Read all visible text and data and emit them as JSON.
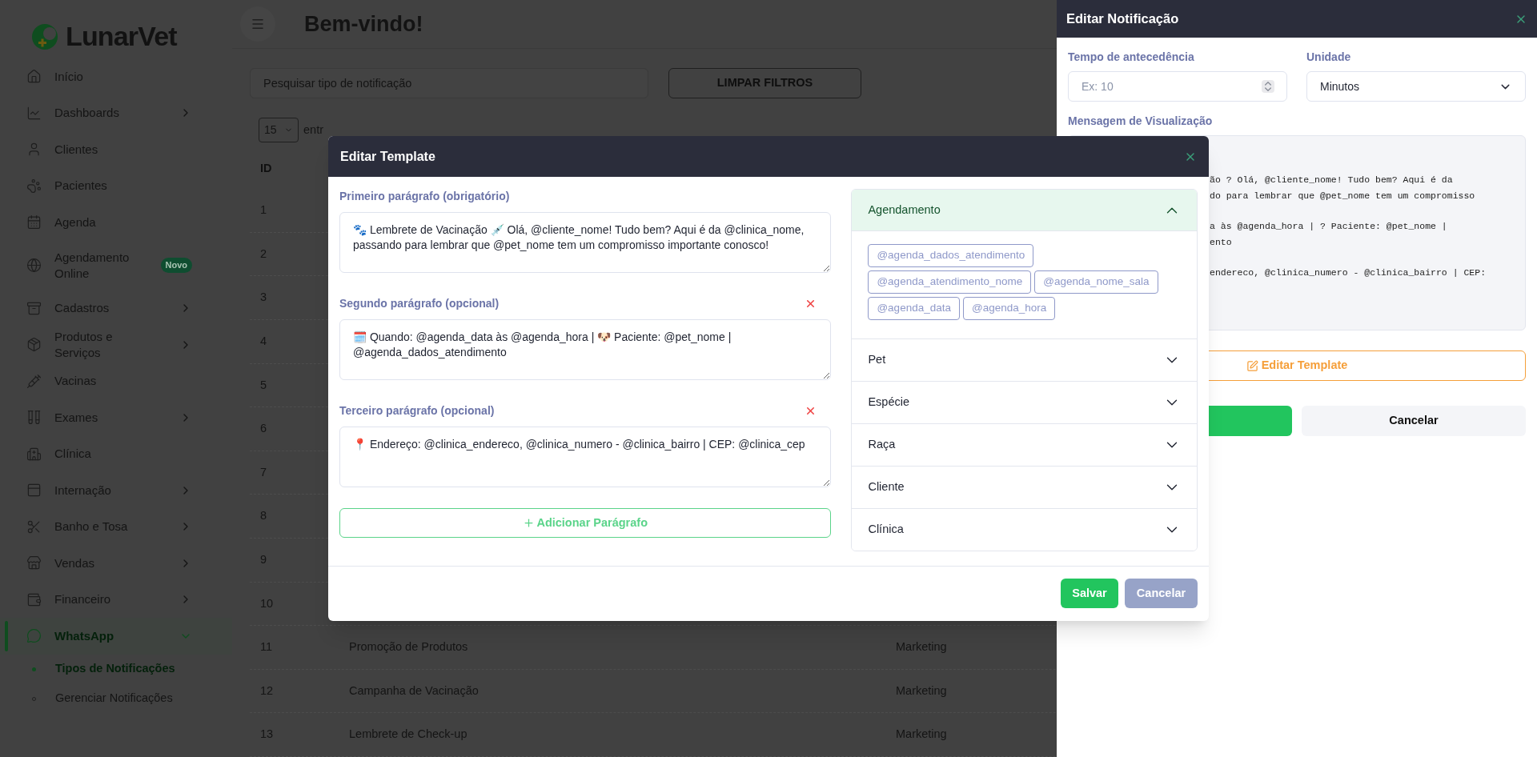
{
  "sidebar": {
    "logo": "LunarVet",
    "items": [
      {
        "label": "Início",
        "expandable": false,
        "selected": false
      },
      {
        "label": "Dashboards",
        "expandable": true,
        "expanded": false,
        "selected": false
      },
      {
        "label": "Clientes",
        "expandable": false,
        "selected": false
      },
      {
        "label": "Pacientes",
        "expandable": false,
        "selected": false
      },
      {
        "label": "Agenda",
        "expandable": false,
        "selected": false
      },
      {
        "label": "Agendamento Online",
        "expandable": false,
        "selected": false,
        "badge": "Novo"
      },
      {
        "label": "Cadastros",
        "expandable": true,
        "expanded": false,
        "selected": false
      },
      {
        "label": "Produtos e Serviços",
        "expandable": true,
        "expanded": false,
        "selected": false
      },
      {
        "label": "Vacinas",
        "expandable": false,
        "selected": false
      },
      {
        "label": "Exames",
        "expandable": true,
        "expanded": false,
        "selected": false
      },
      {
        "label": "Clínica",
        "expandable": false,
        "selected": false
      },
      {
        "label": "Internação",
        "expandable": true,
        "expanded": false,
        "selected": false
      },
      {
        "label": "Banho e Tosa",
        "expandable": true,
        "expanded": false,
        "selected": false
      },
      {
        "label": "Vendas",
        "expandable": true,
        "expanded": false,
        "selected": false
      },
      {
        "label": "Financeiro",
        "expandable": true,
        "expanded": false,
        "selected": false
      },
      {
        "label": "WhatsApp",
        "expandable": true,
        "expanded": true,
        "selected": true,
        "children": [
          {
            "label": "Tipos de Notificações",
            "selected": true
          },
          {
            "label": "Gerenciar Notificações",
            "selected": false
          }
        ]
      }
    ]
  },
  "header": {
    "title": "Bem-vindo!"
  },
  "filters": {
    "search": {
      "placeholder": "Pesquisar tipo de notificação"
    },
    "clear_button": "LIMPAR FILTROS",
    "page_size": "15",
    "page_size_label": "entr"
  },
  "table": {
    "columns": [
      "ID"
    ],
    "rows": [
      {
        "id": "1"
      },
      {
        "id": "2"
      },
      {
        "id": "3"
      },
      {
        "id": "4"
      },
      {
        "id": "5"
      },
      {
        "id": "6"
      },
      {
        "id": "7"
      },
      {
        "id": "8"
      },
      {
        "id": "9"
      },
      {
        "id": "10"
      },
      {
        "id": "11",
        "name": "Promoção de Produtos",
        "category": "Marketing"
      },
      {
        "id": "12",
        "name": "Campanha de Vacinação",
        "category": "Marketing"
      },
      {
        "id": "13",
        "name": "Lembrete de Check-up",
        "category": "Marketing"
      }
    ]
  },
  "drawer": {
    "title": "Editar Notificação",
    "lead_time": {
      "label": "Tempo de antecedência",
      "placeholder": "Ex: 10"
    },
    "unit": {
      "label": "Unidade",
      "value": "Minutos"
    },
    "preview": {
      "label": "Mensagem de Visualização",
      "paragraphs": [
        [
          "ão ? Olá, @cliente_nome! Tudo bem? Aqui é da",
          "do para lembrar que @pet_nome tem um compromisso"
        ],
        [
          "a às @agenda_hora | ? Paciente: @pet_nome |",
          "ento"
        ],
        [
          "endereco, @clinica_numero - @clinica_bairro | CEP:"
        ]
      ]
    },
    "edit_template_button": "Editar Template",
    "cancel_button": "Cancelar"
  },
  "modal": {
    "title": "Editar Template",
    "paragraphs": [
      {
        "label": "Primeiro parágrafo (obrigatório)",
        "removable": false,
        "value": "🐾 Lembrete de Vacinação 💉 Olá, @cliente_nome! Tudo bem? Aqui é da @clinica_nome, passando para lembrar que @pet_nome tem um compromisso importante conosco!"
      },
      {
        "label": "Segundo parágrafo (opcional)",
        "removable": true,
        "value": "🗓️ Quando: @agenda_data às @agenda_hora | 🐶 Paciente: @pet_nome | @agenda_dados_atendimento"
      },
      {
        "label": "Terceiro parágrafo (opcional)",
        "removable": true,
        "value": "📍 Endereço: @clinica_endereco, @clinica_numero - @clinica_bairro | CEP: @clinica_cep"
      }
    ],
    "add_button": "Adicionar Parágrafo",
    "variables": [
      {
        "label": "Agendamento",
        "expanded": true,
        "tags": [
          "@agenda_dados_atendimento",
          "@agenda_atendimento_nome",
          "@agenda_nome_sala",
          "@agenda_data",
          "@agenda_hora"
        ]
      },
      {
        "label": "Pet",
        "expanded": false
      },
      {
        "label": "Espécie",
        "expanded": false
      },
      {
        "label": "Raça",
        "expanded": false
      },
      {
        "label": "Cliente",
        "expanded": false
      },
      {
        "label": "Clínica",
        "expanded": false
      }
    ],
    "save_button": "Salvar",
    "cancel_button": "Cancelar"
  }
}
